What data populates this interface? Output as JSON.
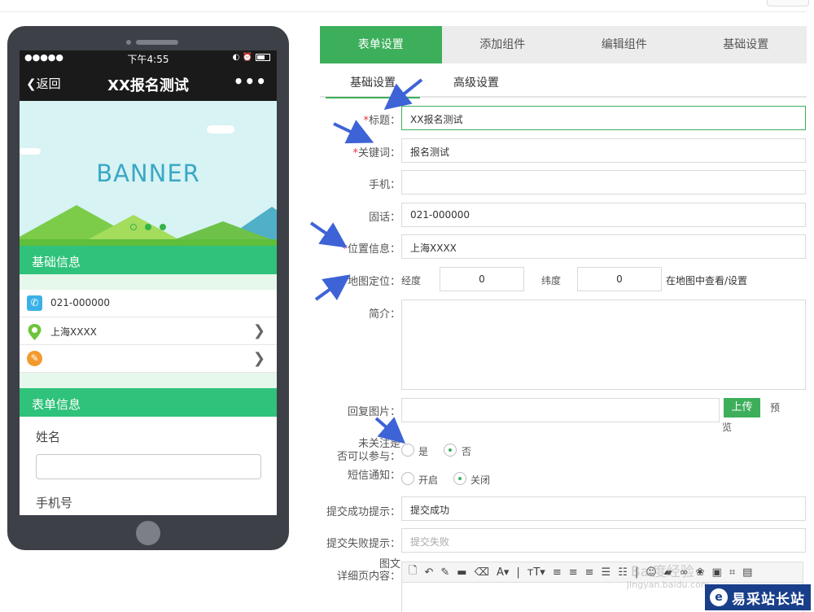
{
  "phone": {
    "status_signal": "●●●●●",
    "status_time": "下午4:55",
    "status_icons": "◐ ⏰",
    "nav_back": "返回",
    "nav_title": "XX报名测试",
    "nav_more": "•••",
    "banner_text": "BANNER",
    "section_basic": "基础信息",
    "phone_value": "021-000000",
    "location_value": "上海XXXX",
    "section_form": "表单信息",
    "field_name": "姓名",
    "field_phone": "手机号"
  },
  "tabs": [
    "表单设置",
    "添加组件",
    "编辑组件",
    "基础设置"
  ],
  "subtabs": [
    "基础设置",
    "高级设置"
  ],
  "form": {
    "title_label": "标题：",
    "title_value": "XX报名测试",
    "keyword_label": "关键词：",
    "keyword_value": "报名测试",
    "mobile_label": "手机：",
    "mobile_value": "",
    "landline_label": "固话：",
    "landline_value": "021-000000",
    "location_label": "位置信息：",
    "location_value": "上海XXXX",
    "map_label": "地图定位：",
    "longitude_label": "经度",
    "longitude_value": "0",
    "latitude_label": "纬度",
    "latitude_value": "0",
    "map_link": "在地图中查看/设置",
    "intro_label": "简介：",
    "reply_image_label": "回复图片：",
    "upload_button": "上传",
    "preview_label_1": "预",
    "preview_label_2": "览",
    "unfollow_label_1": "未关注是",
    "unfollow_label_2": "否可以参与：",
    "yes_label": "是",
    "no_label": "否",
    "sms_label": "短信通知：",
    "sms_on": "开启",
    "sms_off": "关闭",
    "success_label": "提交成功提示：",
    "success_value": "提交成功",
    "fail_label": "提交失败提示：",
    "fail_placeholder": "提交失败",
    "detail_label_1": "图文",
    "detail_label_2": "详细页内容："
  },
  "toolbar_icons": [
    "🗋",
    "↶",
    "✎",
    "▬",
    "⌫",
    "A▾",
    "|",
    "ᴛT▾",
    "≡",
    "≡",
    "≡",
    "☰",
    "☷",
    "|",
    "☺",
    "▰",
    "∞",
    "❀",
    "▣",
    "⌗",
    "▤"
  ],
  "watermark": "jingyan.baidu.com",
  "watermark_top": "Bai度经验",
  "logo_text": "易采站长站",
  "colors": {
    "accent": "#3daf5b",
    "phone_green": "#2fc27a",
    "required": "#e03b3b",
    "arrow": "#3d63d6"
  }
}
